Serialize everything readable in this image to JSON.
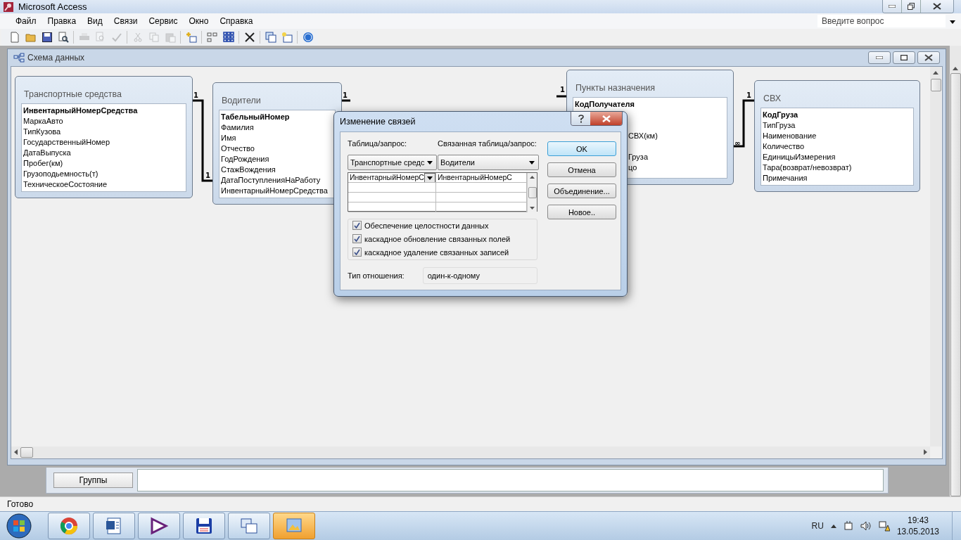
{
  "window": {
    "title": "Microsoft Access"
  },
  "menu": [
    {
      "label": "Файл"
    },
    {
      "label": "Правка"
    },
    {
      "label": "Вид"
    },
    {
      "label": "Связи"
    },
    {
      "label": "Сервис"
    },
    {
      "label": "Окно"
    },
    {
      "label": "Справка"
    }
  ],
  "help_search": {
    "placeholder": "Введите вопрос"
  },
  "toolbar": [
    {
      "kind": "new",
      "disabled": false
    },
    {
      "kind": "open",
      "disabled": false
    },
    {
      "kind": "save",
      "disabled": false
    },
    {
      "kind": "preview",
      "disabled": false
    },
    {
      "kind": "sep"
    },
    {
      "kind": "print",
      "disabled": true
    },
    {
      "kind": "zoom",
      "disabled": true
    },
    {
      "kind": "spell",
      "disabled": true
    },
    {
      "kind": "sep"
    },
    {
      "kind": "cut",
      "disabled": true
    },
    {
      "kind": "copy",
      "disabled": true
    },
    {
      "kind": "paste",
      "disabled": true
    },
    {
      "kind": "sep"
    },
    {
      "kind": "addtable",
      "disabled": false
    },
    {
      "kind": "sep"
    },
    {
      "kind": "direct",
      "disabled": false
    },
    {
      "kind": "all",
      "disabled": false
    },
    {
      "kind": "sep"
    },
    {
      "kind": "delete",
      "disabled": false
    },
    {
      "kind": "sep"
    },
    {
      "kind": "dbwindow",
      "disabled": false
    },
    {
      "kind": "newobject",
      "disabled": false
    },
    {
      "kind": "sep"
    },
    {
      "kind": "help",
      "disabled": false
    }
  ],
  "schema_window": {
    "title": "Схема данных",
    "tables": [
      {
        "title": "Транспортные средства",
        "fields": [
          {
            "name": "ИнвентарныйНомерСредства",
            "key": true,
            "kind": "full"
          },
          {
            "name": "МаркаАвто",
            "key": false,
            "kind": "full"
          },
          {
            "name": "ТипКузова",
            "key": false,
            "kind": "full"
          },
          {
            "name": "ГосударственныйНомер",
            "key": false,
            "kind": "full"
          },
          {
            "name": "ДатаВыпуска",
            "key": false,
            "kind": "full"
          },
          {
            "name": "Пробег(км)",
            "key": false,
            "kind": "full"
          },
          {
            "name": "Грузоподьемность(т)",
            "key": false,
            "kind": "full"
          },
          {
            "name": "ТехническоеСостояние",
            "key": false,
            "kind": "full"
          }
        ]
      },
      {
        "title": "Водители",
        "fields": [
          {
            "name": "ТабельныйНомер",
            "key": true,
            "kind": "full"
          },
          {
            "name": "Фамилия",
            "key": false,
            "kind": "full"
          },
          {
            "name": "Имя",
            "key": false,
            "kind": "full"
          },
          {
            "name": "Отчество",
            "key": false,
            "kind": "full"
          },
          {
            "name": "ГодРождения",
            "key": false,
            "kind": "full"
          },
          {
            "name": "СтажВождения",
            "key": false,
            "kind": "full"
          },
          {
            "name": "ДатаПоступленияНаРаботу",
            "key": false,
            "kind": "full"
          },
          {
            "name": "ИнвентарныйНомерСредства",
            "key": false,
            "kind": "full"
          }
        ]
      },
      {
        "title": "Пункты назначения",
        "fields": [
          {
            "name": "КодПолучателя",
            "key": true,
            "kind": "full"
          },
          {
            "name": "СВХ(км)",
            "key": false,
            "kind": "fragment"
          },
          {
            "name": "Груза",
            "key": false,
            "kind": "fragment"
          },
          {
            "name": "цо",
            "key": false,
            "kind": "fragment"
          }
        ]
      },
      {
        "title": "СВХ",
        "fields": [
          {
            "name": "КодГруза",
            "key": true,
            "kind": "full"
          },
          {
            "name": "ТипГруза",
            "key": false,
            "kind": "full"
          },
          {
            "name": "Наименование",
            "key": false,
            "kind": "full"
          },
          {
            "name": "Количество",
            "key": false,
            "kind": "full"
          },
          {
            "name": "ЕдиницыИзмерения",
            "key": false,
            "kind": "full"
          },
          {
            "name": "Тара(возврат/невозврат)",
            "key": false,
            "kind": "full"
          },
          {
            "name": "Примечания",
            "key": false,
            "kind": "full"
          }
        ]
      }
    ],
    "relations": [
      {
        "labels": [
          "1",
          "1"
        ]
      },
      {
        "labels": [
          "1"
        ]
      },
      {
        "labels": [
          "1"
        ]
      },
      {
        "labels": [
          "∞",
          "1"
        ]
      }
    ]
  },
  "groups_button": "Группы",
  "dialog": {
    "title": "Изменение связей",
    "table_label": "Таблица/запрос:",
    "related_label": "Связанная таблица/запрос:",
    "table_value": "Транспортные средс",
    "related_value": "Водители",
    "grid_rows": [
      {
        "left": "ИнвентарныйНомерС",
        "right": "ИнвентарныйНомерС"
      }
    ],
    "checks": [
      {
        "label": "Обеспечение целостности данных",
        "checked": true
      },
      {
        "label": "каскадное обновление связанных полей",
        "checked": true
      },
      {
        "label": "каскадное удаление связанных записей",
        "checked": true
      }
    ],
    "type_label": "Тип отношения:",
    "type_value": "один-к-одному",
    "buttons": [
      {
        "label": "OK",
        "default": true
      },
      {
        "label": "Отмена",
        "default": false
      },
      {
        "label": "Объединение...",
        "default": false
      },
      {
        "label": "Новое..",
        "default": false
      }
    ]
  },
  "status_bar": "Готово",
  "taskbar": {
    "apps": [
      {
        "kind": "chrome",
        "selected": false
      },
      {
        "kind": "word",
        "selected": false
      },
      {
        "kind": "studio",
        "selected": false
      },
      {
        "kind": "floppy",
        "selected": false
      },
      {
        "kind": "windows",
        "selected": false
      },
      {
        "kind": "access",
        "selected": true
      }
    ],
    "language": "RU",
    "time": "19:43",
    "date": "13.05.2013"
  }
}
